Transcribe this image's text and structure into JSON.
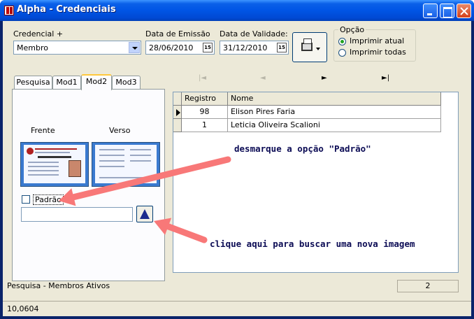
{
  "window": {
    "title": "Alpha - Credenciais"
  },
  "form": {
    "credencial_label": "Credencial +",
    "credencial_value": "Membro",
    "emissao_label": "Data de Emissão",
    "emissao_value": "28/06/2010",
    "validade_label": "Data de Validade:",
    "validade_value": "31/12/2010",
    "calendar_text": "15"
  },
  "opcao": {
    "legend": "Opção",
    "options": [
      {
        "label": "Imprimir atual",
        "selected": true
      },
      {
        "label": "Imprimir todas",
        "selected": false
      }
    ]
  },
  "tabs": [
    "Pesquisa",
    "Mod1",
    "Mod2",
    "Mod3"
  ],
  "active_tab": "Mod2",
  "mod2": {
    "frente_label": "Frente",
    "verso_label": "Verso",
    "padrao_label": "Padrão",
    "padrao_checked": false,
    "image_path_value": ""
  },
  "navigator": {
    "first": "|◄",
    "prev": "◄",
    "next": "►",
    "last": "►|"
  },
  "grid": {
    "columns": [
      "Registro",
      "Nome"
    ],
    "rows": [
      {
        "registro": "98",
        "nome": "Elison Pires Faria"
      },
      {
        "registro": "1",
        "nome": "Leticia Oliveira Scalioni"
      }
    ]
  },
  "status": {
    "text": "Pesquisa - Membros Ativos",
    "count": "2",
    "bottom": "10,0604"
  },
  "annotations": {
    "uncheck": "desmarque a opção \"Padrão\"",
    "click": "clique aqui para buscar uma nova imagem",
    "arrow_color": "#f87878"
  }
}
